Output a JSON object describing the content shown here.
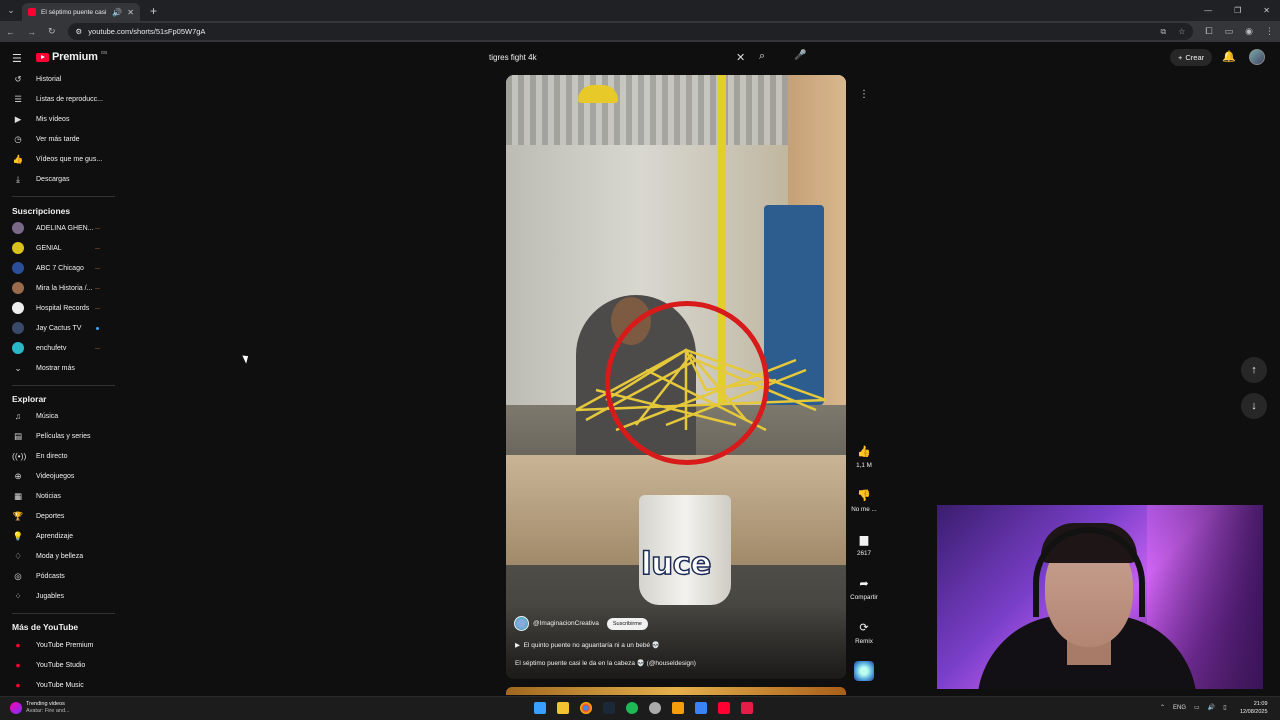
{
  "browser": {
    "tab_title": "El séptimo puente casi le da...",
    "url": "youtube.com/shorts/51sFp05W7gA"
  },
  "header": {
    "logo_text": "Premium",
    "logo_badge": "GB",
    "search_value": "tigres fight  4k",
    "create_label": "Crear"
  },
  "sidebar": {
    "you_items": [
      {
        "icon": "history-icon",
        "glyph": "↺",
        "label": "Historial"
      },
      {
        "icon": "playlist-icon",
        "glyph": "☰",
        "label": "Listas de reproducc..."
      },
      {
        "icon": "my-videos-icon",
        "glyph": "▶",
        "label": "Mis vídeos"
      },
      {
        "icon": "watch-later-icon",
        "glyph": "◷",
        "label": "Ver más tarde"
      },
      {
        "icon": "liked-icon",
        "glyph": "👍",
        "label": "Vídeos que me gus..."
      },
      {
        "icon": "download-icon",
        "glyph": "⤓",
        "label": "Descargas"
      }
    ],
    "subs_title": "Suscripciones",
    "subscriptions": [
      {
        "label": "ADELINA GHEN...",
        "color": "#7a6a8a",
        "badge": "live"
      },
      {
        "label": "GENIAL",
        "color": "#d9c21a",
        "badge": "live"
      },
      {
        "label": "ABC 7 Chicago",
        "color": "#2b4e9a",
        "badge": "live"
      },
      {
        "label": "Mira la Historia /...",
        "color": "#9a6a4a",
        "badge": "live"
      },
      {
        "label": "Hospital Records",
        "color": "#eeeeee",
        "badge": "live"
      },
      {
        "label": "Jay Cactus TV",
        "color": "#3a4a6a",
        "badge": "new"
      },
      {
        "label": "enchufetv",
        "color": "#2ab8c8",
        "badge": "live"
      }
    ],
    "show_more": "Mostrar más",
    "explore_title": "Explorar",
    "explore_items": [
      {
        "icon": "music-icon",
        "glyph": "♫",
        "label": "Música"
      },
      {
        "icon": "movies-icon",
        "glyph": "▤",
        "label": "Películas y series"
      },
      {
        "icon": "live-icon",
        "glyph": "((•))",
        "label": "En directo"
      },
      {
        "icon": "gaming-icon",
        "glyph": "⊕",
        "label": "Videojuegos"
      },
      {
        "icon": "news-icon",
        "glyph": "▦",
        "label": "Noticias"
      },
      {
        "icon": "sports-icon",
        "glyph": "🏆",
        "label": "Deportes"
      },
      {
        "icon": "learning-icon",
        "glyph": "💡",
        "label": "Aprendizaje"
      },
      {
        "icon": "fashion-icon",
        "glyph": "♢",
        "label": "Moda y belleza"
      },
      {
        "icon": "podcasts-icon",
        "glyph": "◎",
        "label": "Pódcasts"
      },
      {
        "icon": "playables-icon",
        "glyph": "⁘",
        "label": "Jugables"
      }
    ],
    "more_title": "Más de YouTube",
    "more_items": [
      {
        "icon": "yt-premium-icon",
        "label": "YouTube Premium"
      },
      {
        "icon": "yt-studio-icon",
        "label": "YouTube Studio"
      },
      {
        "icon": "yt-music-icon",
        "label": "YouTube Music"
      }
    ]
  },
  "short": {
    "caption": "luce",
    "channel": "@ImaginacionCreativa",
    "subscribe_label": "Suscribirme",
    "playlist_line": "El quinto puente no aguantaría ni a un bebé 💀",
    "title": "El séptimo puente casi le da en la cabeza 💀 (@houseldesign)"
  },
  "actions": {
    "like_count": "1,1 M",
    "dislike_label": "No me ...",
    "comment_count": "2617",
    "share_label": "Compartir",
    "remix_label": "Remix"
  },
  "taskbar": {
    "trend_title": "Trending videos",
    "trend_sub": "Avatar: Fire and...",
    "lang": "ENG",
    "time": "21:09",
    "date": "12/08/2025"
  }
}
